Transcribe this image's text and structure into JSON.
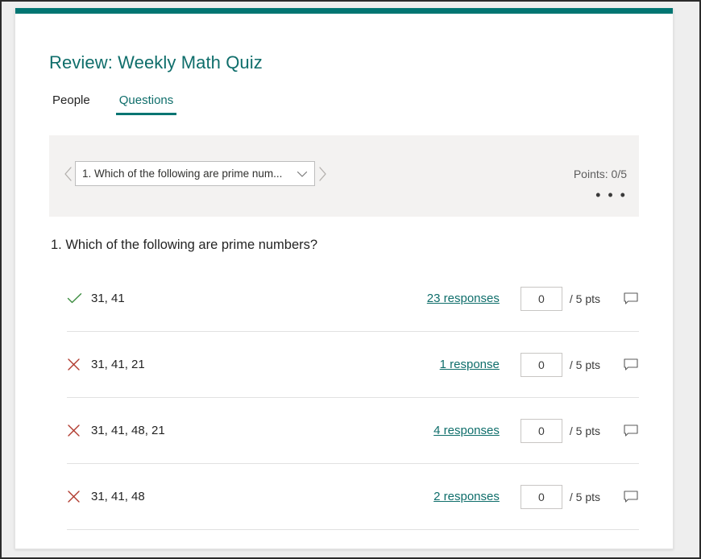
{
  "window": {
    "accent_color": "#017572"
  },
  "header": {
    "title": "Review: Weekly Math Quiz"
  },
  "tabs": [
    {
      "label": "People",
      "active": false
    },
    {
      "label": "Questions",
      "active": true
    }
  ],
  "question_nav": {
    "prev_icon": "chevron-left-icon",
    "next_icon": "chevron-right-icon",
    "selected_question": "1. Which of the following are prime num...",
    "dropdown_icon": "chevron-down-icon",
    "points_label": "Points: 0/5",
    "more_options_label": "• • •"
  },
  "question": {
    "heading": "1. Which of the following are prime numbers?",
    "answers": [
      {
        "mark": "check-icon",
        "correct": true,
        "text": "31, 41",
        "responses_link": "23 responses",
        "score_value": "0",
        "points_label": "/ 5 pts",
        "comment_icon": "comment-icon"
      },
      {
        "mark": "x-icon",
        "correct": false,
        "text": "31, 41, 21",
        "responses_link": "1 response",
        "score_value": "0",
        "points_label": "/ 5 pts",
        "comment_icon": "comment-icon"
      },
      {
        "mark": "x-icon",
        "correct": false,
        "text": "31, 41, 48, 21",
        "responses_link": "4 responses",
        "score_value": "0",
        "points_label": "/ 5 pts",
        "comment_icon": "comment-icon"
      },
      {
        "mark": "x-icon",
        "correct": false,
        "text": "31, 41, 48",
        "responses_link": "2 responses",
        "score_value": "0",
        "points_label": "/ 5 pts",
        "comment_icon": "comment-icon"
      }
    ]
  },
  "colors": {
    "teal": "#017572",
    "link_teal": "#0f6e6b",
    "correct_green": "#3b8c3f",
    "incorrect_red": "#b03a2e",
    "panel_gray": "#f3f2f1"
  }
}
